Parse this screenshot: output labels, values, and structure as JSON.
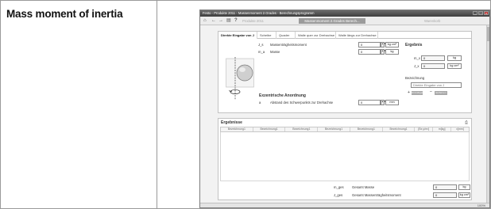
{
  "page": {
    "heading": "Mass moment of inertia"
  },
  "window": {
    "title": "Festo - Produkte 2011 - Massenmoment 2.Grades - Berechnungsprogramm",
    "controls": [
      "_",
      "□",
      "x"
    ]
  },
  "toolbar": {
    "icons": [
      "home-icon",
      "back-arrow-icon",
      "forward-arrow-icon",
      "save-icon",
      "help-icon"
    ],
    "product_label": "Produkte 2011",
    "active_badge": "Massenmoment 2.Grades Berech...",
    "right_label": "Warenkorb"
  },
  "tabs": [
    {
      "label": "Direkte Eingabe von J",
      "active": true
    },
    {
      "label": "Scheibe",
      "active": false
    },
    {
      "label": "Quader",
      "active": false
    },
    {
      "label": "Walle quer zur Drehachse",
      "active": false
    },
    {
      "label": "Walle längs zur Drehachse",
      "active": false
    }
  ],
  "inputs": {
    "inertia": {
      "symbol": "J_s",
      "label": "Massenträgheitsmoment",
      "value": "0",
      "unit": "kg cm²"
    },
    "mass": {
      "symbol": "m_a",
      "label": "Masse",
      "value": "0",
      "unit": "kg"
    },
    "eccentric": {
      "section_title": "Exzentrische Anordnung",
      "symbol": "a",
      "label": "Abstand des Schwerpunkts zur Drehachse",
      "value": "0",
      "unit": "mm"
    }
  },
  "results": {
    "title": "Ergebnis",
    "mass": {
      "symbol": "m_x",
      "value": "0",
      "unit": "kg"
    },
    "inertia": {
      "symbol": "J_x",
      "value": "0",
      "unit": "kg cm²"
    },
    "designation": {
      "label": "Bezeichnung",
      "placeholder": "Direkte Eingabe von J",
      "add_label": "Hinzufügen",
      "remove_label": "Entfernen"
    }
  },
  "results_table": {
    "title": "Ergebnisse",
    "columns": [
      "Bezeichnung1",
      "Bezeichnung1",
      "Bezeichnung1",
      "Bezeichnung1",
      "Bezeichnung1",
      "Bezeichnung1",
      "[Bx,y/m²]",
      "m[kg]",
      "x[mm]"
    ],
    "total_mass": {
      "symbol": "m_ges",
      "label": "Gesamt Masse",
      "value": "0",
      "unit": "kg"
    },
    "total_inertia": {
      "symbol": "J_ges",
      "label": "Gesamt Massenträgheitsmoment",
      "value": "0",
      "unit": "kg cm²"
    }
  },
  "status": {
    "zoom": "100%"
  }
}
